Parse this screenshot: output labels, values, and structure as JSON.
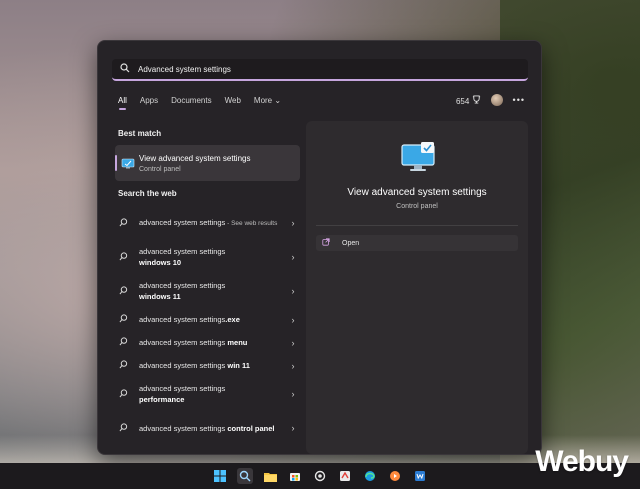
{
  "search": {
    "value": "Advanced system settings"
  },
  "tabs": [
    {
      "label": "All",
      "active": true
    },
    {
      "label": "Apps"
    },
    {
      "label": "Documents"
    },
    {
      "label": "Web"
    },
    {
      "label": "More"
    }
  ],
  "header": {
    "points": "654"
  },
  "best_match": {
    "section_title": "Best match",
    "title": "View advanced system settings",
    "subtitle": "Control panel"
  },
  "web": {
    "section_title": "Search the web",
    "items": [
      {
        "prefix": "advanced system settings",
        "bold": "",
        "hint": " - See web results"
      },
      {
        "prefix": "advanced system settings",
        "bold": "windows 10",
        "hint": ""
      },
      {
        "prefix": "advanced system settings",
        "bold": "windows 11",
        "hint": ""
      },
      {
        "prefix": "advanced system settings",
        "bold": ".exe",
        "hint": ""
      },
      {
        "prefix": "advanced system settings",
        "bold": "menu",
        "hint": ""
      },
      {
        "prefix": "advanced system settings",
        "bold": "win 11",
        "hint": ""
      },
      {
        "prefix": "advanced system settings",
        "bold": "performance",
        "hint": ""
      },
      {
        "prefix": "advanced system settings",
        "bold": "control panel",
        "hint": ""
      }
    ]
  },
  "preview": {
    "title": "View advanced system settings",
    "subtitle": "Control panel",
    "open_label": "Open"
  },
  "watermark": "Webuy",
  "colors": {
    "accent": "#c6a6de",
    "panel": "#262327"
  }
}
